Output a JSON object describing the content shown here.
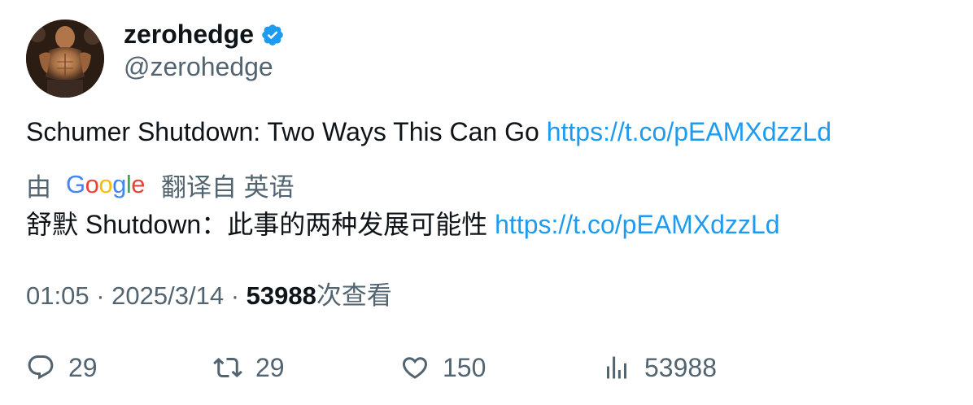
{
  "author": {
    "display_name": "zerohedge",
    "handle": "@zerohedge",
    "verified": true,
    "avatar_icon": "avatar-photo"
  },
  "tweet": {
    "text": "Schumer Shutdown: Two Ways This Can Go",
    "link": "https://t.co/pEAMXdzzLd"
  },
  "translation": {
    "prefix": "由",
    "provider_logo": "Google",
    "suffix": "翻译自 英语",
    "text": "舒默 Shutdown：此事的两种发展可能性",
    "link": "https://t.co/pEAMXdzzLd"
  },
  "meta": {
    "time": "01:05",
    "separator": "·",
    "date": "2025/3/14",
    "views_count": "53988",
    "views_label": "次查看"
  },
  "actions": {
    "reply_count": "29",
    "retweet_count": "29",
    "like_count": "150",
    "views_count": "53988"
  },
  "colors": {
    "link": "#1d9bf0",
    "secondary_text": "#536471",
    "primary_text": "#0f1419",
    "verified_badge": "#1d9bf0"
  }
}
